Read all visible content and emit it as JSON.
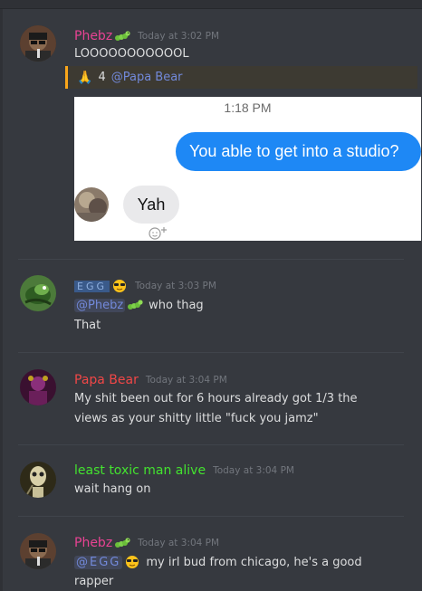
{
  "messages": [
    {
      "username": "Phebz",
      "time": "Today at 3:02 PM",
      "text": "LOOOOOOOOOOOL"
    },
    {
      "reaction": {
        "emoji": "🙏",
        "count": "4",
        "mention": "@Papa Bear"
      }
    },
    {
      "embed": {
        "time": "1:18 PM",
        "outgoing": "You able to get into a studio?",
        "incoming": "Yah"
      }
    },
    {
      "username": "EGG",
      "time": "Today at 3:03 PM",
      "mention": "@Phebz",
      "text1": "who thag",
      "text2": "That"
    },
    {
      "username": "Papa Bear",
      "time": "Today at 3:04 PM",
      "text1": "My shit been out for 6 hours already got 1/3 the",
      "text2": "views as your shitty little \"fuck you jamz\""
    },
    {
      "username": "least toxic man alive",
      "time": "Today at 3:04 PM",
      "text": "wait hang on"
    },
    {
      "username": "Phebz",
      "time": "Today at 3:04 PM",
      "mention": "@EGG",
      "text1": "my irl bud from chicago, he's a good",
      "text2": "rapper"
    }
  ],
  "colors": {
    "background": "#36393f",
    "phebz": "#e84393",
    "papa_bear": "#f04747",
    "least_toxic": "#43e32f",
    "egg": "#4f76b3",
    "mention": "#7289da",
    "imessage_blue": "#1e88f5"
  },
  "icons": [
    "caterpillar-badge-icon",
    "sunglasses-emoji-icon",
    "pray-emoji-icon",
    "add-reaction-icon"
  ]
}
